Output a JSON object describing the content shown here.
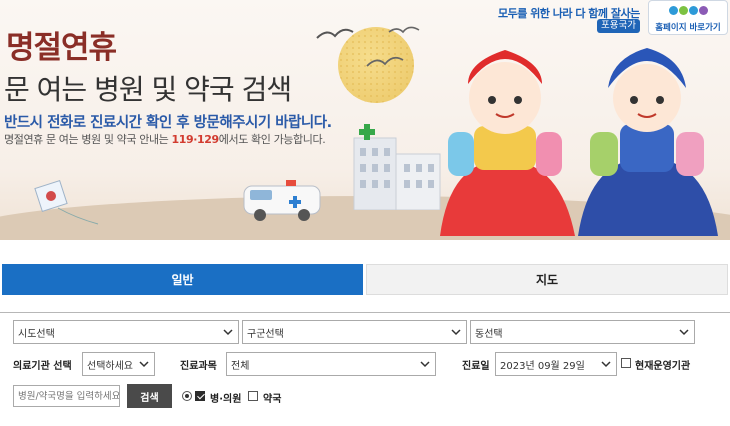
{
  "banner": {
    "title_main": "명절연휴",
    "title_sub": "문 여는 병원 및 약국 검색",
    "notice": "반드시 전화로 진료시간 확인 후 방문해주시기 바랍니다.",
    "info_prefix": "명절연휴 문 여는 병원 및 약국 안내는 ",
    "info_numbers": "119·129",
    "info_suffix": "에서도 확인 가능합니다.",
    "slogan": "모두를 위한 나라 다 함께 잘사는",
    "nation_badge": "포용국가",
    "home_button": "홈페이지 바로가기",
    "colors": {
      "title": "#8a2e27",
      "notice": "#2a5aa8",
      "phone": "#d23b2f"
    }
  },
  "tabs": [
    {
      "label": "일반",
      "active": true
    },
    {
      "label": "지도",
      "active": false
    }
  ],
  "search": {
    "sido_select": "시도선택",
    "gugun_select": "구군선택",
    "dong_select": "동선택",
    "institution_label": "의료기관 선택",
    "institution_select": "선택하세요",
    "department_label": "진료과목",
    "department_select": "전체",
    "date_label": "진료일",
    "date_select": "2023년 09월 29일",
    "operating_now_label": "현재운영기관",
    "name_placeholder": "병원/약국명을 입력하세요",
    "search_button": "검색",
    "hospital_label": "병·의원",
    "pharmacy_label": "약국",
    "colors": {
      "active_tab": "#1a6fc4",
      "search_button": "#4a4a4a"
    }
  }
}
